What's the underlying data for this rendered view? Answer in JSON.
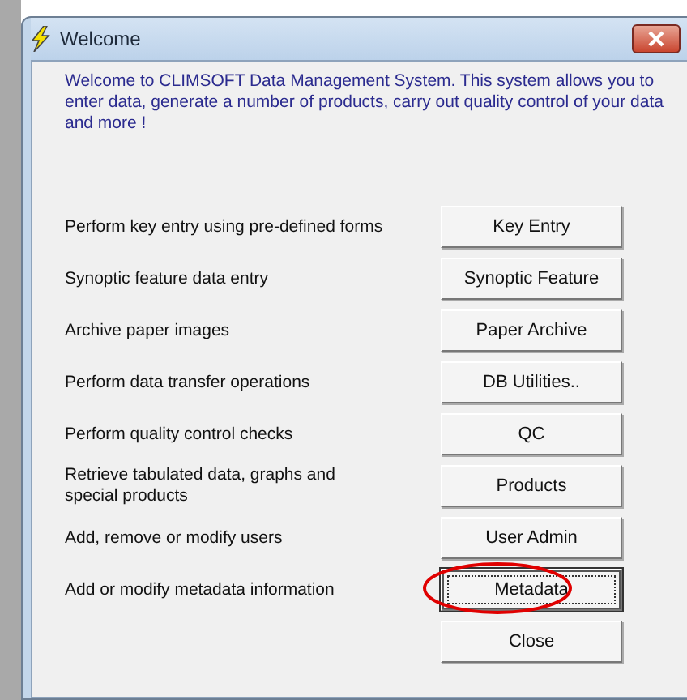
{
  "window": {
    "title": "Welcome"
  },
  "intro": "Welcome to CLIMSOFT Data Management System. This system allows you to enter data, generate a number of products, carry out quality control of your data and more !",
  "actions": [
    {
      "description": "Perform key entry using pre-defined forms",
      "button": "Key Entry",
      "focused": false
    },
    {
      "description": "Synoptic feature data entry",
      "button": "Synoptic Feature",
      "focused": false
    },
    {
      "description": "Archive paper images",
      "button": "Paper Archive",
      "focused": false
    },
    {
      "description": "Perform data transfer operations",
      "button": "DB Utilities..",
      "focused": false
    },
    {
      "description": "Perform quality control checks",
      "button": "QC",
      "focused": false
    },
    {
      "description": "Retrieve tabulated data, graphs and special products",
      "button": "Products",
      "focused": false
    },
    {
      "description": "Add, remove or modify users",
      "button": "User Admin",
      "focused": false
    },
    {
      "description": "Add or modify metadata information",
      "button": "Metadata",
      "focused": true,
      "highlighted": true
    },
    {
      "button": "Close",
      "focused": false
    }
  ]
}
